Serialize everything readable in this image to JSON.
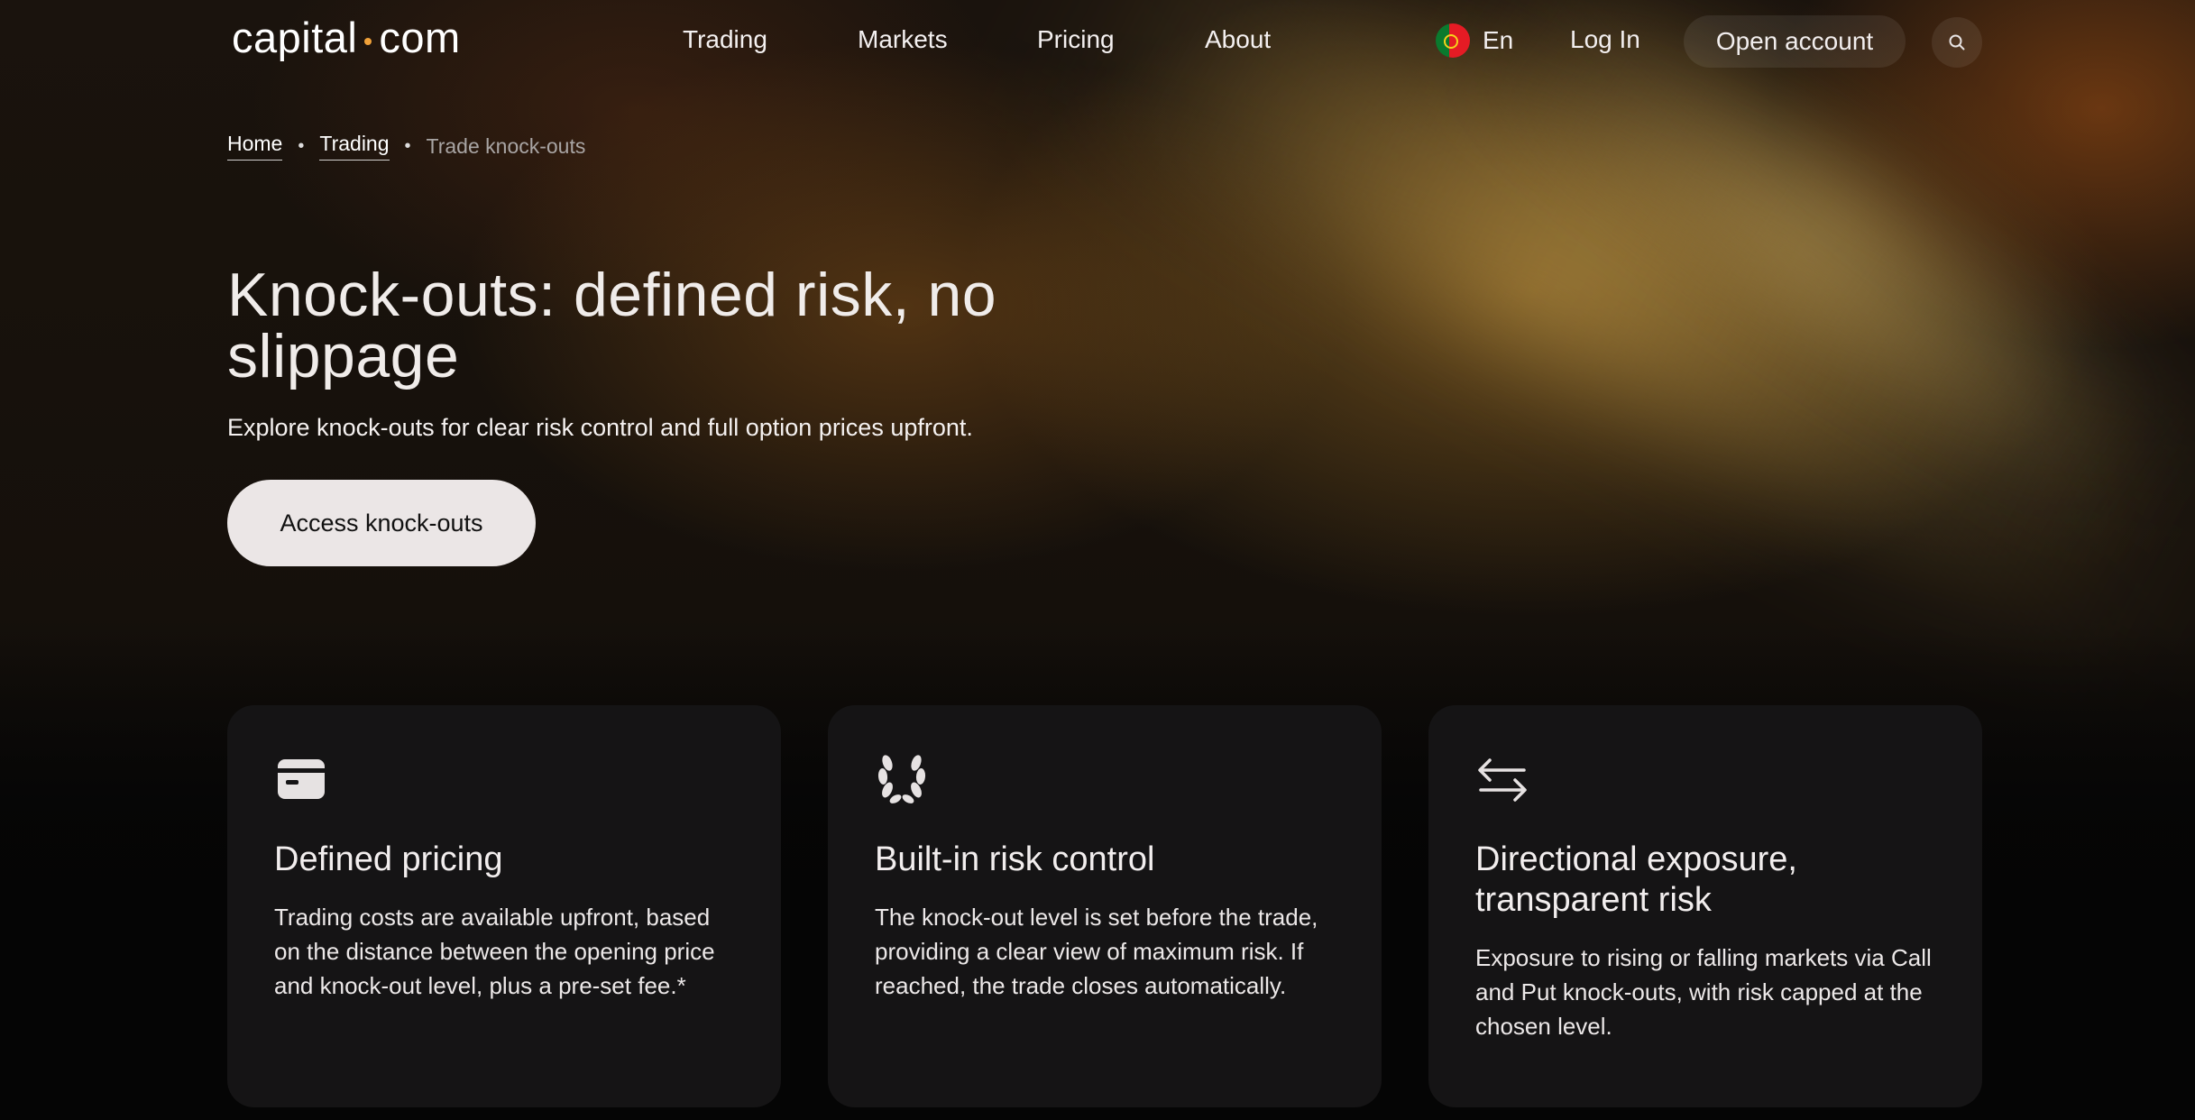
{
  "header": {
    "logo_left": "capital",
    "logo_right": "com",
    "nav": [
      "Trading",
      "Markets",
      "Pricing",
      "About"
    ],
    "language": "En",
    "login_label": "Log In",
    "open_account_label": "Open account",
    "search_icon": "search-icon",
    "flag_icon": "portugal-flag-icon"
  },
  "breadcrumb": {
    "home": "Home",
    "trading": "Trading",
    "current": "Trade knock-outs"
  },
  "hero": {
    "title": "Knock-outs: defined risk, no slippage",
    "subtitle": "Explore knock-outs for clear risk control and full option prices upfront.",
    "cta_label": "Access knock-outs"
  },
  "cards": [
    {
      "icon": "card-icon",
      "title": "Defined pricing",
      "text": "Trading costs are available upfront, based on the distance between the opening price and knock-out level, plus a pre-set fee.*"
    },
    {
      "icon": "laurel-icon",
      "title": "Built-in risk control",
      "text": "The knock-out level is set before the trade, providing a clear view of maximum risk. If reached, the trade closes automatically."
    },
    {
      "icon": "arrows-exchange-icon",
      "title": "Directional exposure, transparent risk",
      "text": "Exposure to rising or falling markets via Call and Put knock-outs, with risk capped at the chosen level."
    }
  ],
  "colors": {
    "accent_dot": "#f1a23a",
    "card_bg": "#151415",
    "cta_bg": "#ebe6e6"
  }
}
